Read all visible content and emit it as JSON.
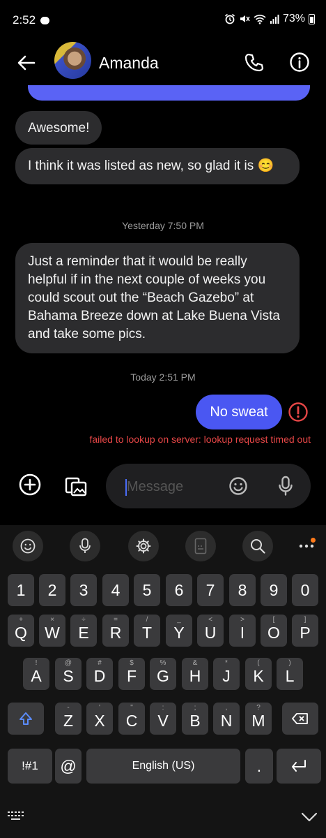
{
  "status": {
    "time": "2:52",
    "battery": "73%"
  },
  "header": {
    "contact_name": "Amanda"
  },
  "messages": {
    "m1": "Awesome!",
    "m2": "I think it was listed as new, so glad it is 😊",
    "ts1_day": "Yesterday",
    "ts1_time": "7:50 PM",
    "m3": "Just a reminder that it would be really helpful if in the next couple of weeks you could scout out the “Beach Gazebo” at Bahama Breeze down at Lake Buena Vista and take some pics.",
    "ts2_day": "Today",
    "ts2_time": "2:51 PM",
    "out": "No sweat",
    "error": "failed to lookup on server: lookup request timed out"
  },
  "composer": {
    "placeholder": "Message"
  },
  "keyboard": {
    "numbers": [
      "1",
      "2",
      "3",
      "4",
      "5",
      "6",
      "7",
      "8",
      "9",
      "0"
    ],
    "row_q": [
      {
        "k": "Q",
        "s": "+"
      },
      {
        "k": "W",
        "s": "×"
      },
      {
        "k": "E",
        "s": "÷"
      },
      {
        "k": "R",
        "s": "="
      },
      {
        "k": "T",
        "s": "/"
      },
      {
        "k": "Y",
        "s": "_"
      },
      {
        "k": "U",
        "s": "<"
      },
      {
        "k": "I",
        "s": ">"
      },
      {
        "k": "O",
        "s": "["
      },
      {
        "k": "P",
        "s": "]"
      }
    ],
    "row_a": [
      {
        "k": "A",
        "s": "!"
      },
      {
        "k": "S",
        "s": "@"
      },
      {
        "k": "D",
        "s": "#"
      },
      {
        "k": "F",
        "s": "$"
      },
      {
        "k": "G",
        "s": "%"
      },
      {
        "k": "H",
        "s": "&"
      },
      {
        "k": "J",
        "s": "*"
      },
      {
        "k": "K",
        "s": "("
      },
      {
        "k": "L",
        "s": ")"
      }
    ],
    "row_z": [
      {
        "k": "Z",
        "s": "-"
      },
      {
        "k": "X",
        "s": "'"
      },
      {
        "k": "C",
        "s": "\""
      },
      {
        "k": "V",
        "s": ":"
      },
      {
        "k": "B",
        "s": ";"
      },
      {
        "k": "N",
        "s": ","
      },
      {
        "k": "M",
        "s": "?"
      }
    ],
    "sym_label": "!#1",
    "at_label": "@",
    "space_label": "English (US)",
    "dot_label": "."
  },
  "colors": {
    "sent_bubble": "#4a57f2",
    "received_bubble": "#2c2c2e",
    "error": "#e54646",
    "accent_dot": "#ff7a1a"
  }
}
